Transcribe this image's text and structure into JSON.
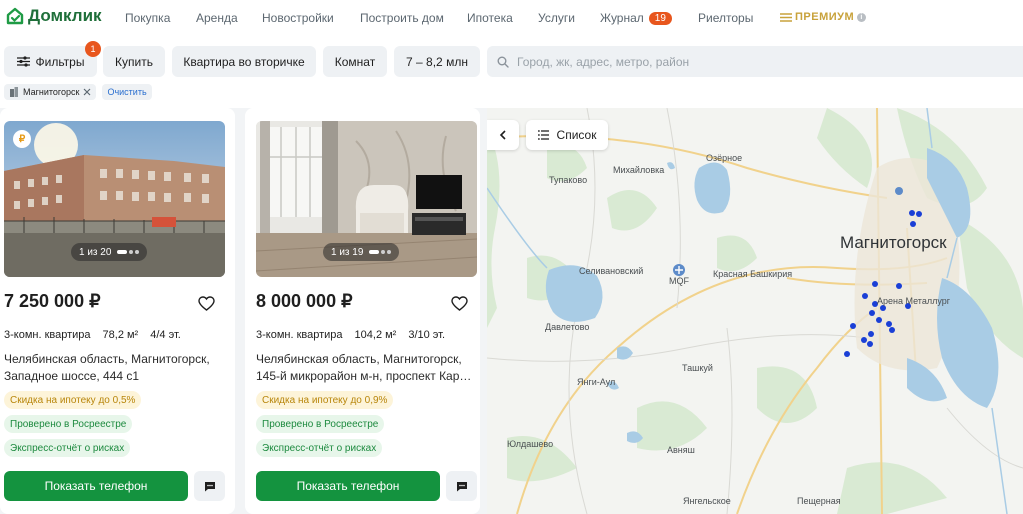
{
  "nav": {
    "logo": "Домклик",
    "items": [
      "Покупка",
      "Аренда",
      "Новостройки",
      "Построить дом",
      "Ипотека",
      "Услуги",
      "Журнал",
      "Риелторы"
    ],
    "journal_badge": "19",
    "premium": "ПРЕМИУМ"
  },
  "filters": {
    "filters_label": "Фильтры",
    "filters_count": "1",
    "buy": "Купить",
    "type": "Квартира во вторичке",
    "rooms": "Комнат",
    "price": "7 – 8,2 млн",
    "search_placeholder": "Город, жк, адрес, метро, район"
  },
  "chips": {
    "city": "Магнитогорск",
    "clear": "Очистить"
  },
  "listings": [
    {
      "photo_counter": "1 из 20",
      "price": "7 250 000 ₽",
      "rooms": "3-комн. квартира",
      "area": "78,2 м²",
      "floor": "4/4 эт.",
      "address": "Челябинская область, Магнитогорск, Западное шоссе, 444 с1",
      "tags": [
        "Скидка на ипотеку до 0,5%",
        "Проверено в Росреестре",
        "Экспресс-отчёт о рисках"
      ],
      "phone": "Показать телефон"
    },
    {
      "photo_counter": "1 из 19",
      "price": "8 000 000 ₽",
      "rooms": "3-комн. квартира",
      "area": "104,2 м²",
      "floor": "3/10 эт.",
      "address": "Челябинская область, Магнитогорск, 145-й микрорайон м-н, проспект Кар…",
      "tags": [
        "Скидка на ипотеку до 0,9%",
        "Проверено в Росреестре",
        "Экспресс-отчёт о рисках"
      ],
      "phone": "Показать телефон"
    }
  ],
  "map": {
    "list_label": "Список",
    "city": "Магнитогорск",
    "places": [
      "Озёрное",
      "Михайловка",
      "Тупаково",
      "Селивановский",
      "MQF",
      "Красная Башкирия",
      "Давлетово",
      "Янги-Аул",
      "Ташкуй",
      "Юлдашево",
      "Авняш",
      "Янгельское",
      "Пещерная",
      "Арена Металлург"
    ]
  }
}
